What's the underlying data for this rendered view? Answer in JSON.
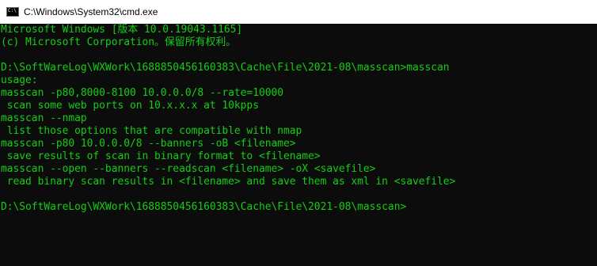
{
  "window": {
    "title": "C:\\Windows\\System32\\cmd.exe",
    "icon": "cmd-prompt-icon",
    "icon_glyph": "C:\\",
    "text_color": "#13cf13",
    "background_color": "#0c0c0c"
  },
  "console": {
    "lines": [
      "Microsoft Windows [版本 10.0.19043.1165]",
      "(c) Microsoft Corporation。保留所有权利。",
      "",
      "D:\\SoftWareLog\\WXWork\\1688850456160383\\Cache\\File\\2021-08\\masscan>masscan",
      "usage:",
      "masscan -p80,8000-8100 10.0.0.0/8 --rate=10000",
      " scan some web ports on 10.x.x.x at 10kpps",
      "masscan --nmap",
      " list those options that are compatible with nmap",
      "masscan -p80 10.0.0.0/8 --banners -oB <filename>",
      " save results of scan in binary format to <filename>",
      "masscan --open --banners --readscan <filename> -oX <savefile>",
      " read binary scan results in <filename> and save them as xml in <savefile>",
      "",
      "D:\\SoftWareLog\\WXWork\\1688850456160383\\Cache\\File\\2021-08\\masscan>"
    ]
  }
}
